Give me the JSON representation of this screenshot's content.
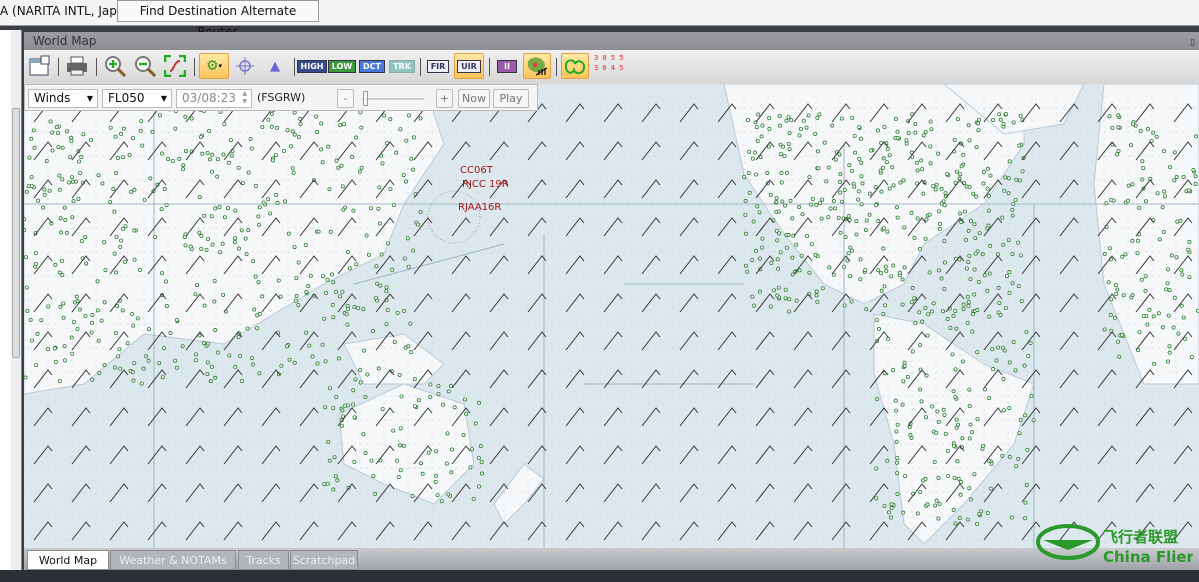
{
  "topbar": {
    "route_text": "A (NARITA INTL, Japan)",
    "find_button": "Find Destination Alternate Routes"
  },
  "panel": {
    "title": "World Map",
    "pin_icon": "pin-icon"
  },
  "toolbar": {
    "chips": {
      "high": "HIGH",
      "low": "LOW",
      "dct": "DCT",
      "trk": "TRK",
      "fir": "FIR",
      "uir": "UIR",
      "two": "II"
    },
    "chip_colors": {
      "high": "#3b4a8c",
      "low": "#3c9a3c",
      "dct": "#4a7adf",
      "trk": "#8fc4c0",
      "fir": "#eef",
      "uir": "#eef",
      "two": "#9a5aa8"
    },
    "readout": [
      "3 0 5 5",
      "3 0 4 5"
    ]
  },
  "subbar": {
    "layer": "Winds",
    "level": "FL050",
    "time": "03/08:23",
    "source": "(FSGRW)",
    "minus": "-",
    "plus": "+",
    "now": "Now",
    "play": "Play"
  },
  "map": {
    "labels": [
      "CC06T",
      "RJCC 19R",
      "RJAA16R"
    ],
    "ocean_color": "#dde7ee",
    "land_color": "#f5f7f9",
    "airport_color": "#2e7d32"
  },
  "tabs": [
    {
      "label": "World Map",
      "active": true
    },
    {
      "label": "Weather & NOTAMs"
    },
    {
      "label": "Tracks"
    },
    {
      "label": "Scratchpad"
    }
  ],
  "watermark": {
    "cn": "飞行者联盟",
    "en": "China Flier"
  }
}
